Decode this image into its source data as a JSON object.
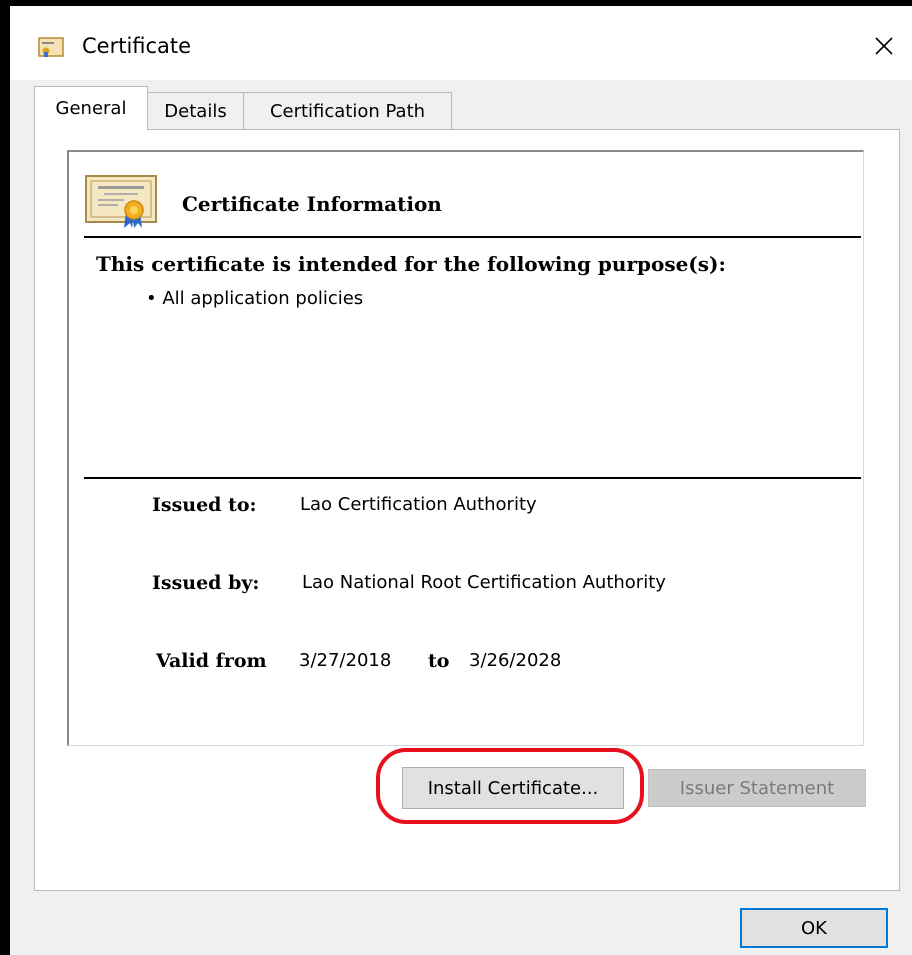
{
  "window": {
    "title": "Certificate",
    "close_icon": "close-icon",
    "title_icon": "certificate-icon"
  },
  "tabs": [
    {
      "label": "General",
      "selected": true
    },
    {
      "label": "Details",
      "selected": false
    },
    {
      "label": "Certification Path",
      "selected": false
    }
  ],
  "general": {
    "heading": "Certificate Information",
    "purpose_heading": "This certificate is intended for the following purpose(s):",
    "purposes": [
      "• All application policies"
    ],
    "issued_to_label": "Issued to:",
    "issued_to": "Lao Certification Authority",
    "issued_by_label": "Issued by:",
    "issued_by": "Lao National Root Certification Authority",
    "valid_from_label": "Valid from",
    "valid_from": "3/27/2018",
    "valid_to_label": "to",
    "valid_to": "3/26/2028"
  },
  "buttons": {
    "install": "Install Certificate...",
    "issuer_statement": "Issuer Statement",
    "ok": "OK"
  },
  "colors": {
    "highlight": "#e8101e",
    "default_button_border": "#0078d7"
  }
}
